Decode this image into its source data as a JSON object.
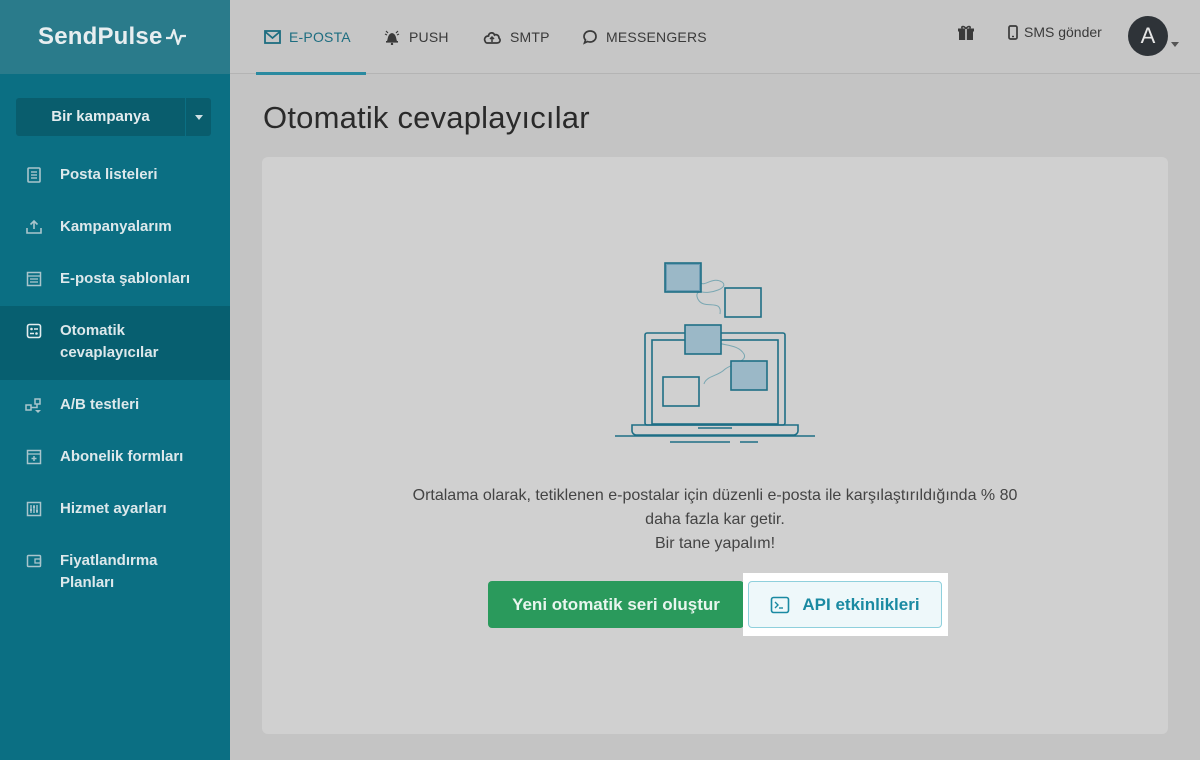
{
  "brand": {
    "name": "SendPulse"
  },
  "sidebar": {
    "campaign_button": "Bir kampanya",
    "items": [
      {
        "label": "Posta listeleri",
        "icon": "list-icon"
      },
      {
        "label": "Kampanyalarım",
        "icon": "upload-icon"
      },
      {
        "label": "E-posta şablonları",
        "icon": "template-icon"
      },
      {
        "label": "Otomatik cevaplayıcılar",
        "icon": "autoresponder-icon",
        "active": true
      },
      {
        "label": "A/B testleri",
        "icon": "ab-test-icon"
      },
      {
        "label": "Abonelik formları",
        "icon": "form-icon"
      },
      {
        "label": "Hizmet ayarları",
        "icon": "settings-sliders-icon"
      },
      {
        "label": "Fiyatlandırma Planları",
        "icon": "wallet-icon"
      }
    ]
  },
  "topbar": {
    "tabs": [
      {
        "label": "E-POSTA",
        "icon": "envelope-icon",
        "active": true
      },
      {
        "label": "PUSH",
        "icon": "bell-icon"
      },
      {
        "label": "SMTP",
        "icon": "cloud-upload-icon"
      },
      {
        "label": "MESSENGERS",
        "icon": "chat-icon"
      }
    ],
    "sms_label": "SMS gönder",
    "avatar_letter": "A"
  },
  "main": {
    "title": "Otomatik cevaplayıcılar",
    "description_line1": "Ortalama olarak, tetiklenen e-postalar için düzenli e-posta ile karşılaştırıldığında % 80",
    "description_line2": "daha fazla kar getir.",
    "description_line3": "Bir tane yapalım!",
    "primary_button": "Yeni otomatik seri oluştur",
    "secondary_button": "API etkinlikleri"
  },
  "colors": {
    "sidebar": "#0b6f83",
    "primary_button": "#2a9a5c",
    "accent": "#1a8aa2"
  }
}
